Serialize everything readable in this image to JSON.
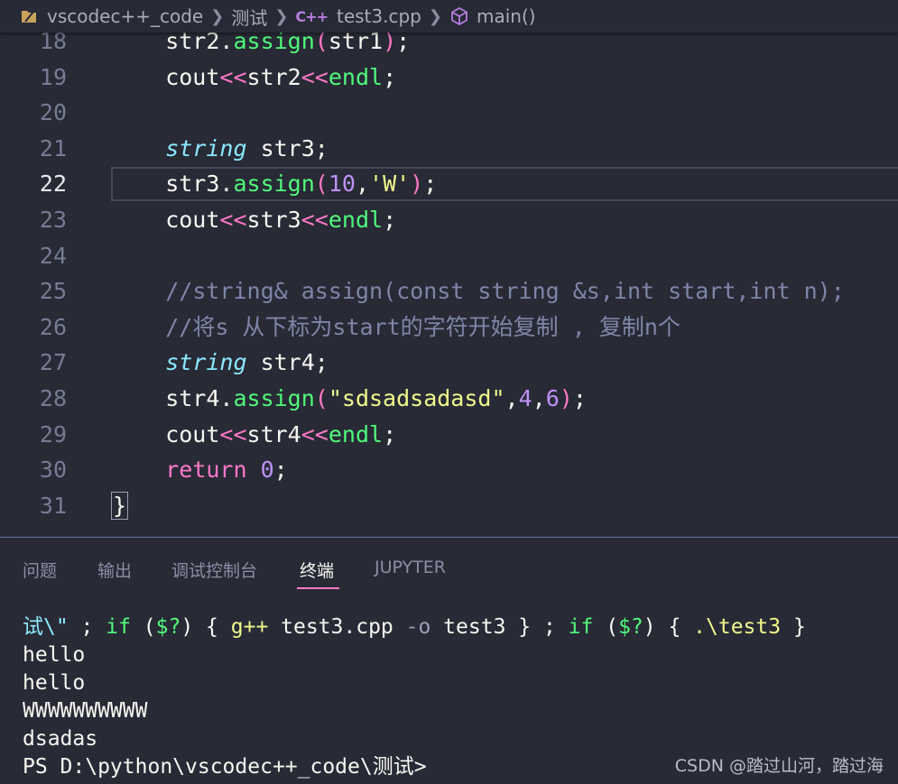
{
  "breadcrumb": {
    "folder": "vscodec++_code",
    "subfolder": "测试",
    "file_icon": "C++",
    "file": "test3.cpp",
    "symbol": "main()"
  },
  "editor": {
    "active_line": 22,
    "lines": [
      {
        "num": "18",
        "tokens": [
          [
            "",
            "    str2."
          ],
          [
            "method",
            "assign"
          ],
          [
            "paren",
            "("
          ],
          [
            "",
            "str1"
          ],
          [
            "paren",
            ")"
          ],
          [
            "",
            ";"
          ]
        ]
      },
      {
        "num": "19",
        "tokens": [
          [
            "",
            "    cout"
          ],
          [
            "op",
            "<<"
          ],
          [
            "",
            "str2"
          ],
          [
            "op",
            "<<"
          ],
          [
            "method",
            "endl"
          ],
          [
            "",
            ";"
          ]
        ]
      },
      {
        "num": "20",
        "tokens": []
      },
      {
        "num": "21",
        "tokens": [
          [
            "",
            "    "
          ],
          [
            "type",
            "string"
          ],
          [
            "",
            " str3;"
          ]
        ]
      },
      {
        "num": "22",
        "tokens": [
          [
            "",
            "    str3."
          ],
          [
            "method",
            "assign"
          ],
          [
            "paren",
            "("
          ],
          [
            "num",
            "10"
          ],
          [
            "",
            ","
          ],
          [
            "str",
            "'W'"
          ],
          [
            "paren",
            ")"
          ],
          [
            "",
            ";"
          ]
        ]
      },
      {
        "num": "23",
        "tokens": [
          [
            "",
            "    cout"
          ],
          [
            "op",
            "<<"
          ],
          [
            "",
            "str3"
          ],
          [
            "op",
            "<<"
          ],
          [
            "method",
            "endl"
          ],
          [
            "",
            ";"
          ]
        ]
      },
      {
        "num": "24",
        "tokens": []
      },
      {
        "num": "25",
        "tokens": [
          [
            "",
            "    "
          ],
          [
            "comment",
            "//string& assign(const string &s,int start,int n);"
          ]
        ]
      },
      {
        "num": "26",
        "tokens": [
          [
            "",
            "    "
          ],
          [
            "comment",
            "//将s 从下标为start的字符开始复制 , 复制n个"
          ]
        ]
      },
      {
        "num": "27",
        "tokens": [
          [
            "",
            "    "
          ],
          [
            "type",
            "string"
          ],
          [
            "",
            " str4;"
          ]
        ]
      },
      {
        "num": "28",
        "tokens": [
          [
            "",
            "    str4."
          ],
          [
            "method",
            "assign"
          ],
          [
            "paren",
            "("
          ],
          [
            "str",
            "\"sdsadsadasd\""
          ],
          [
            "",
            ","
          ],
          [
            "num",
            "4"
          ],
          [
            "",
            ","
          ],
          [
            "num",
            "6"
          ],
          [
            "paren",
            ")"
          ],
          [
            "",
            ";"
          ]
        ]
      },
      {
        "num": "29",
        "tokens": [
          [
            "",
            "    cout"
          ],
          [
            "op",
            "<<"
          ],
          [
            "",
            "str4"
          ],
          [
            "op",
            "<<"
          ],
          [
            "method",
            "endl"
          ],
          [
            "",
            ";"
          ]
        ]
      },
      {
        "num": "30",
        "tokens": [
          [
            "",
            "    "
          ],
          [
            "kw",
            "return"
          ],
          [
            "",
            " "
          ],
          [
            "num",
            "0"
          ],
          [
            "",
            ";"
          ]
        ]
      },
      {
        "num": "31",
        "tokens": [
          [
            "brace",
            "}"
          ]
        ]
      }
    ]
  },
  "panel": {
    "tabs": [
      "问题",
      "输出",
      "调试控制台",
      "终端",
      "JUPYTER"
    ],
    "active_tab": "终端"
  },
  "terminal": {
    "lines": [
      [
        [
          "cyan",
          "试\\\""
        ],
        [
          "",
          " ; "
        ],
        [
          "green",
          "if"
        ],
        [
          "",
          " ("
        ],
        [
          "green",
          "$?"
        ],
        [
          "",
          ") { "
        ],
        [
          "yellow",
          "g++"
        ],
        [
          "",
          " test3.cpp "
        ],
        [
          "dim",
          "-o"
        ],
        [
          "",
          " test3 } ; "
        ],
        [
          "green",
          "if"
        ],
        [
          "",
          " ("
        ],
        [
          "green",
          "$?"
        ],
        [
          "",
          ") { "
        ],
        [
          "yellow",
          ".\\test3"
        ],
        [
          "",
          " }"
        ]
      ],
      [
        [
          "",
          "hello"
        ]
      ],
      [
        [
          "",
          "hello"
        ]
      ],
      [
        [
          "",
          "WWWWWWWWWW"
        ]
      ],
      [
        [
          "",
          "dsadas"
        ]
      ],
      [
        [
          "",
          "PS D:\\python\\vscodec++_code\\测试>"
        ]
      ]
    ]
  },
  "watermark": "CSDN @踏过山河，踏过海"
}
